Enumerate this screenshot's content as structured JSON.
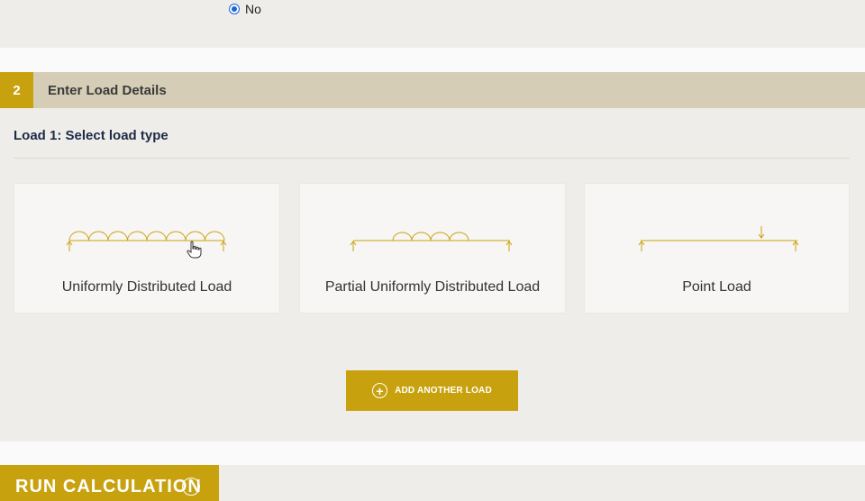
{
  "previous_question": {
    "selected_option": "No"
  },
  "step": {
    "number": "2",
    "title": "Enter Load Details"
  },
  "load": {
    "heading": "Load 1: Select load type",
    "types": [
      {
        "label": "Uniformly Distributed Load",
        "icon": "udl-beam-icon"
      },
      {
        "label": "Partial Uniformly Distributed Load",
        "icon": "partial-udl-beam-icon"
      },
      {
        "label": "Point Load",
        "icon": "point-load-beam-icon"
      }
    ]
  },
  "actions": {
    "add_load": "ADD ANOTHER LOAD",
    "run_calculation": "RUN CALCULATION"
  },
  "colors": {
    "accent": "#c8a20e",
    "header_bar": "#d6cdb6",
    "background": "#efedea",
    "heading_text": "#1c2b46"
  }
}
